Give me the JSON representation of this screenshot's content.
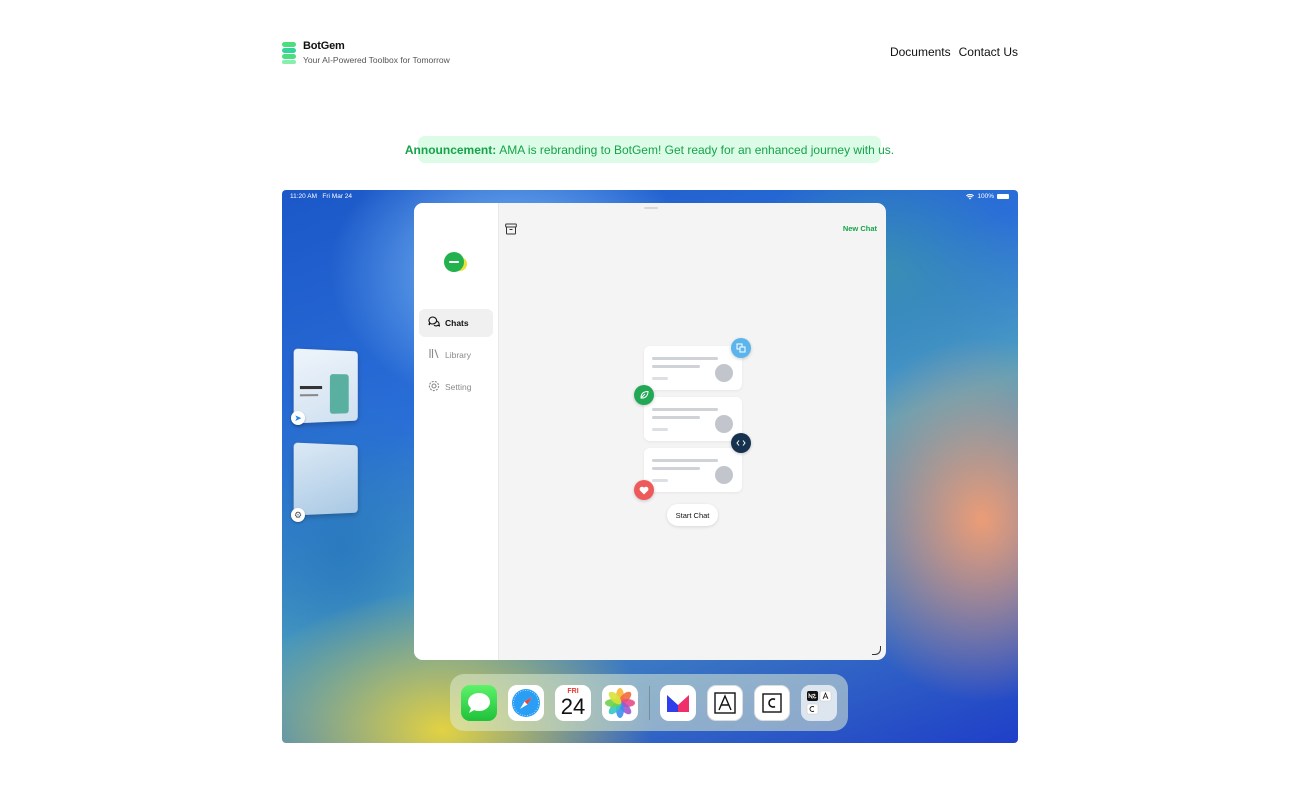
{
  "brand": {
    "name": "BotGem",
    "tagline": "Your AI-Powered Toolbox for Tomorrow"
  },
  "nav": {
    "documents": "Documents",
    "contact": "Contact Us"
  },
  "announcement": {
    "label": "Announcement:",
    "text": "AMA is rebranding to BotGem! Get ready for an enhanced journey with us."
  },
  "device": {
    "time": "11:20 AM",
    "date": "Fri Mar 24",
    "battery": "100%"
  },
  "app": {
    "new_chat": "New Chat",
    "sidebar": [
      {
        "label": "Chats",
        "icon": "chat-bubbles-icon"
      },
      {
        "label": "Library",
        "icon": "library-icon"
      },
      {
        "label": "Setting",
        "icon": "gear-icon"
      }
    ],
    "start_chat": "Start Chat"
  },
  "dock": {
    "calendar_day": "FRI",
    "calendar_date": "24",
    "apps": [
      "messages",
      "safari",
      "calendar",
      "photos",
      "app-m",
      "app-a",
      "app-c",
      "app-folder"
    ]
  },
  "colors": {
    "accent_green": "#16a34a",
    "announcement_bg": "#dcfce7"
  }
}
